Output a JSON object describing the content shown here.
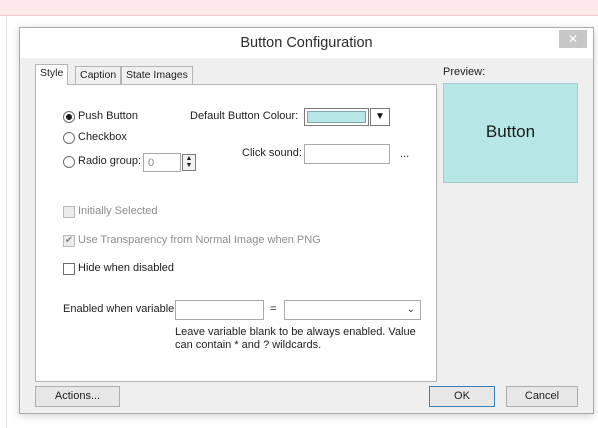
{
  "dialog": {
    "title": "Button Configuration",
    "close_glyph": "✕"
  },
  "tabs": [
    "Style",
    "Caption",
    "State Images"
  ],
  "preview": {
    "label": "Preview:",
    "button_text": "Button",
    "colour": "#b6e6e6"
  },
  "button_type": {
    "push_button": "Push Button",
    "checkbox": "Checkbox",
    "radio_group": "Radio group:",
    "radio_group_value": "0",
    "selected": "push_button"
  },
  "default_colour": {
    "label": "Default Button Colour:",
    "colour": "#b6e6e6",
    "arrow_icon": "triangle-down"
  },
  "click_sound": {
    "label": "Click sound:",
    "value": "",
    "browse_label": "..."
  },
  "options": {
    "initially_selected": {
      "label": "Initially Selected",
      "checked": false,
      "enabled": false
    },
    "use_transparency": {
      "label": "Use Transparency from Normal Image when PNG",
      "checked": true,
      "enabled": false
    },
    "hide_when_disabled": {
      "label": "Hide when disabled",
      "checked": false,
      "enabled": true
    }
  },
  "enabled_when": {
    "label": "Enabled when variable",
    "variable_value": "",
    "equals": "=",
    "comparison_value": "",
    "hint_line1": "Leave variable blank to be always enabled. Value",
    "hint_line2": "can contain * and ? wildcards."
  },
  "footer": {
    "actions": "Actions...",
    "ok": "OK",
    "cancel": "Cancel"
  }
}
